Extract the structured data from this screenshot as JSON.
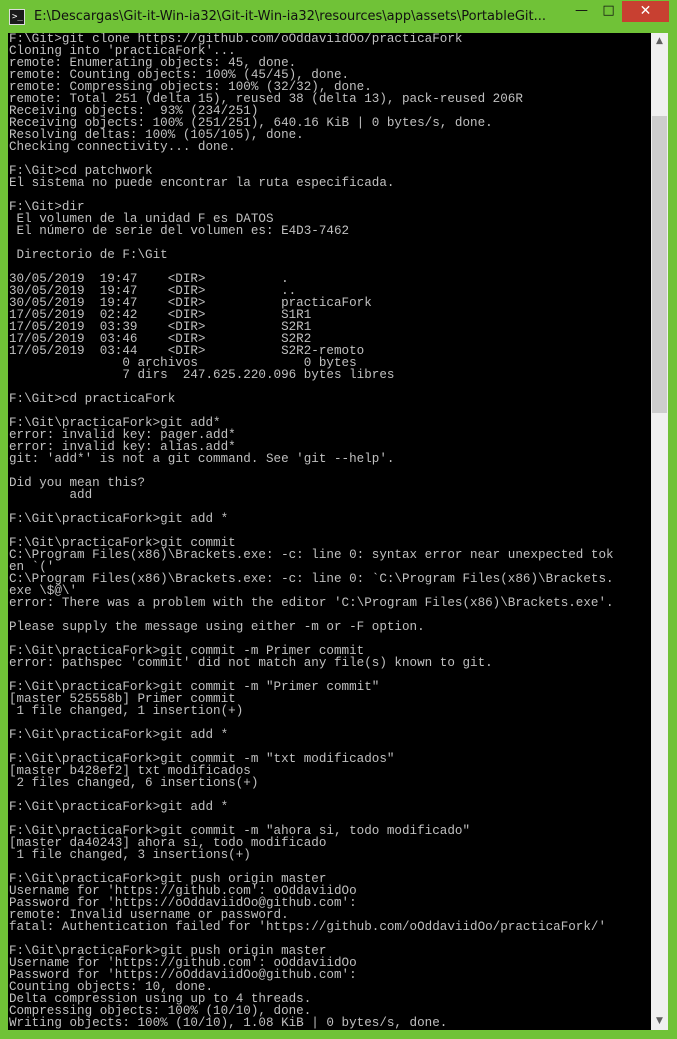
{
  "window": {
    "title": "E:\\Descargas\\Git-it-Win-ia32\\Git-it-Win-ia32\\resources\\app\\assets\\PortableGit...",
    "icon": "terminal-icon",
    "controls": {
      "minimize": "—",
      "maximize": "□",
      "close": "✕"
    },
    "colors": {
      "frame": "#70c237",
      "close_button": "#c84031",
      "console_background": "#000000",
      "console_text": "#c0c0c0"
    }
  },
  "console": {
    "lines": [
      "F:\\Git>git clone https://github.com/oOddaviidOo/practicaFork",
      "Cloning into 'practicaFork'...",
      "remote: Enumerating objects: 45, done.",
      "remote: Counting objects: 100% (45/45), done.",
      "remote: Compressing objects: 100% (32/32), done.",
      "remote: Total 251 (delta 15), reused 38 (delta 13), pack-reused 206R",
      "Receiving objects:  93% (234/251)",
      "Receiving objects: 100% (251/251), 640.16 KiB | 0 bytes/s, done.",
      "Resolving deltas: 100% (105/105), done.",
      "Checking connectivity... done.",
      "",
      "F:\\Git>cd patchwork",
      "El sistema no puede encontrar la ruta especificada.",
      "",
      "F:\\Git>dir",
      " El volumen de la unidad F es DATOS",
      " El número de serie del volumen es: E4D3-7462",
      "",
      " Directorio de F:\\Git",
      "",
      "30/05/2019  19:47    <DIR>          .",
      "30/05/2019  19:47    <DIR>          ..",
      "30/05/2019  19:47    <DIR>          practicaFork",
      "17/05/2019  02:42    <DIR>          S1R1",
      "17/05/2019  03:39    <DIR>          S2R1",
      "17/05/2019  03:46    <DIR>          S2R2",
      "17/05/2019  03:44    <DIR>          S2R2-remoto",
      "               0 archivos              0 bytes",
      "               7 dirs  247.625.220.096 bytes libres",
      "",
      "F:\\Git>cd practicaFork",
      "",
      "F:\\Git\\practicaFork>git add*",
      "error: invalid key: pager.add*",
      "error: invalid key: alias.add*",
      "git: 'add*' is not a git command. See 'git --help'.",
      "",
      "Did you mean this?",
      "        add",
      "",
      "F:\\Git\\practicaFork>git add *",
      "",
      "F:\\Git\\practicaFork>git commit",
      "C:\\Program Files(x86)\\Brackets.exe: -c: line 0: syntax error near unexpected tok",
      "en `('",
      "C:\\Program Files(x86)\\Brackets.exe: -c: line 0: `C:\\Program Files(x86)\\Brackets.",
      "exe \\$@\\'",
      "error: There was a problem with the editor 'C:\\Program Files(x86)\\Brackets.exe'.",
      "",
      "Please supply the message using either -m or -F option.",
      "",
      "F:\\Git\\practicaFork>git commit -m Primer commit",
      "error: pathspec 'commit' did not match any file(s) known to git.",
      "",
      "F:\\Git\\practicaFork>git commit -m \"Primer commit\"",
      "[master 525558b] Primer commit",
      " 1 file changed, 1 insertion(+)",
      "",
      "F:\\Git\\practicaFork>git add *",
      "",
      "F:\\Git\\practicaFork>git commit -m \"txt modificados\"",
      "[master b428ef2] txt modificados",
      " 2 files changed, 6 insertions(+)",
      "",
      "F:\\Git\\practicaFork>git add *",
      "",
      "F:\\Git\\practicaFork>git commit -m \"ahora si, todo modificado\"",
      "[master da40243] ahora si, todo modificado",
      " 1 file changed, 3 insertions(+)",
      "",
      "F:\\Git\\practicaFork>git push origin master",
      "Username for 'https://github.com': oOddaviidOo",
      "Password for 'https://oOddaviidOo@github.com':",
      "remote: Invalid username or password.",
      "fatal: Authentication failed for 'https://github.com/oOddaviidOo/practicaFork/'",
      "",
      "F:\\Git\\practicaFork>git push origin master",
      "Username for 'https://github.com': oOddaviidOo",
      "Password for 'https://oOddaviidOo@github.com':",
      "Counting objects: 10, done.",
      "Delta compression using up to 4 threads.",
      "Compressing objects: 100% (10/10), done.",
      "Writing objects: 100% (10/10), 1.08 KiB | 0 bytes/s, done."
    ]
  },
  "scrollbar": {
    "up_icon": "scroll-up-arrow-icon",
    "down_icon": "scroll-down-arrow-icon",
    "up_glyph": "▲",
    "down_glyph": "▼"
  }
}
